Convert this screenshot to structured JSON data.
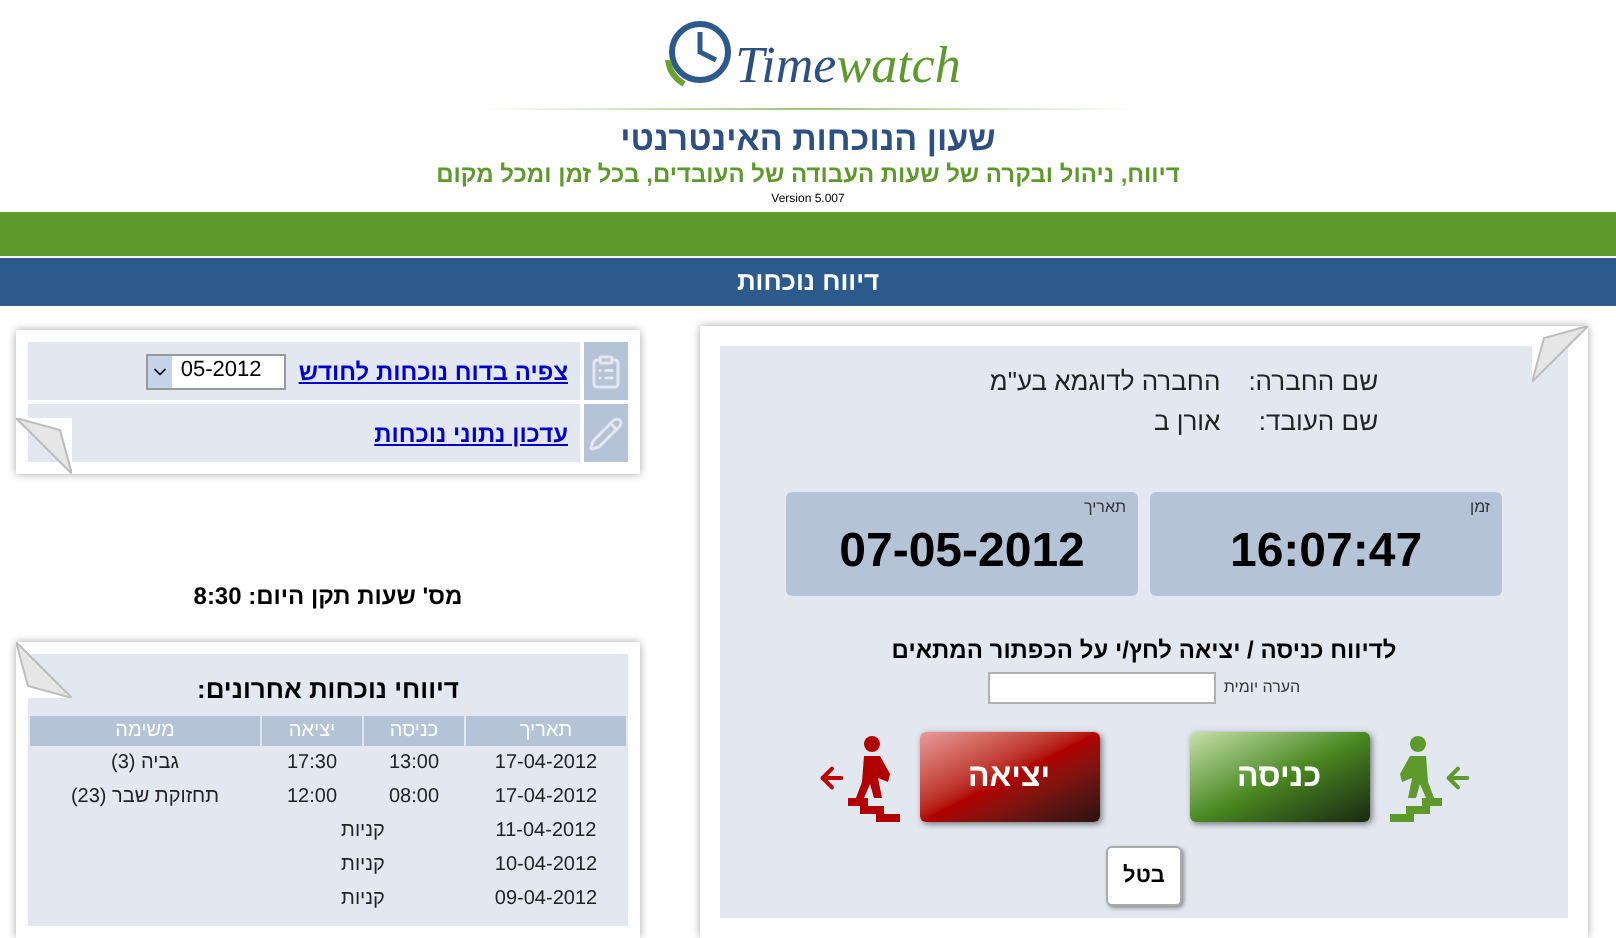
{
  "header": {
    "logo_first": "Time",
    "logo_second": "watch",
    "title": "שעון הנוכחות האינטרנטי",
    "subtitle": "דיווח, ניהול ובקרה של שעות העבודה של העובדים, בכל זמן ומכל מקום",
    "version": "Version 5.007"
  },
  "nav_bar": {
    "title": "דיווח נוכחות"
  },
  "links": [
    {
      "kind": "month",
      "label": "צפיה בדוח נוכחות לחודש",
      "select_value": "05-2012"
    },
    {
      "kind": "edit",
      "label": "עדכון נתוני נוכחות"
    }
  ],
  "standard_hours": "מס' שעות תקן היום: 8:30",
  "recent_reports": {
    "title": "דיווחי נוכחות אחרונים:",
    "columns": [
      "תאריך",
      "כניסה",
      "יציאה",
      "משימה"
    ],
    "rows": [
      {
        "kind": "work",
        "date": "17-04-2012",
        "in": "13:00",
        "out": "17:30",
        "task": "גביה (3)"
      },
      {
        "kind": "work",
        "date": "17-04-2012",
        "in": "08:00",
        "out": "12:00",
        "task": "תחזוקת שבר (23)"
      },
      {
        "kind": "absence",
        "date": "11-04-2012",
        "reason": "קניות"
      },
      {
        "kind": "absence",
        "date": "10-04-2012",
        "reason": "קניות"
      },
      {
        "kind": "absence",
        "date": "09-04-2012",
        "reason": "קניות"
      }
    ]
  },
  "employee": {
    "company_label": "שם החברה:",
    "company_value": "החברה לדוגמא בע\"מ",
    "employee_label": "שם העובד:",
    "employee_value": "אורן ב"
  },
  "clock": [
    {
      "label": "זמן",
      "value": "16:07:47"
    },
    {
      "label": "תאריך",
      "value": "07-05-2012"
    }
  ],
  "instruction": "לדיווח כניסה / יציאה לחץ/י על הכפתור המתאים",
  "comment": {
    "label": "הערה יומית"
  },
  "buttons": {
    "entry": "כניסה",
    "exit": "יציאה",
    "cancel": "בטל"
  }
}
